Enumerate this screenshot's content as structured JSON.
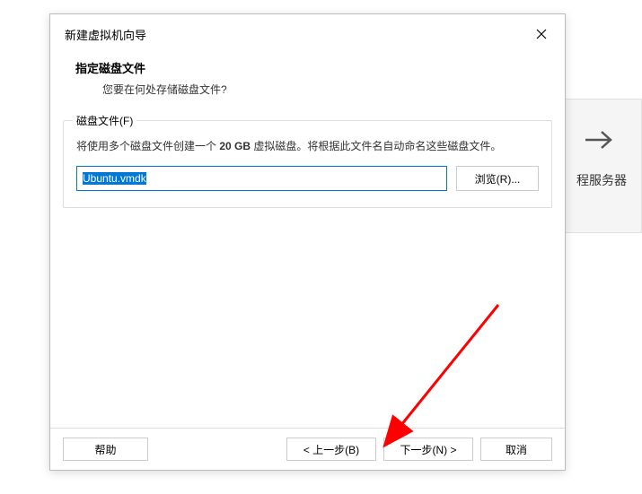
{
  "background": {
    "label": "程服务器"
  },
  "dialog": {
    "title": "新建虚拟机向导",
    "heading": "指定磁盘文件",
    "subheading": "您要在何处存储磁盘文件?",
    "groupbox": {
      "legend": "磁盘文件(F)",
      "description_prefix": "将使用多个磁盘文件创建一个 ",
      "description_bold": "20 GB",
      "description_suffix": " 虚拟磁盘。将根据此文件名自动命名这些磁盘文件。",
      "input_value": "Ubuntu.vmdk",
      "browse_label": "浏览(R)..."
    },
    "footer": {
      "help_label": "帮助",
      "back_label": "< 上一步(B)",
      "next_label": "下一步(N) >",
      "cancel_label": "取消"
    }
  }
}
